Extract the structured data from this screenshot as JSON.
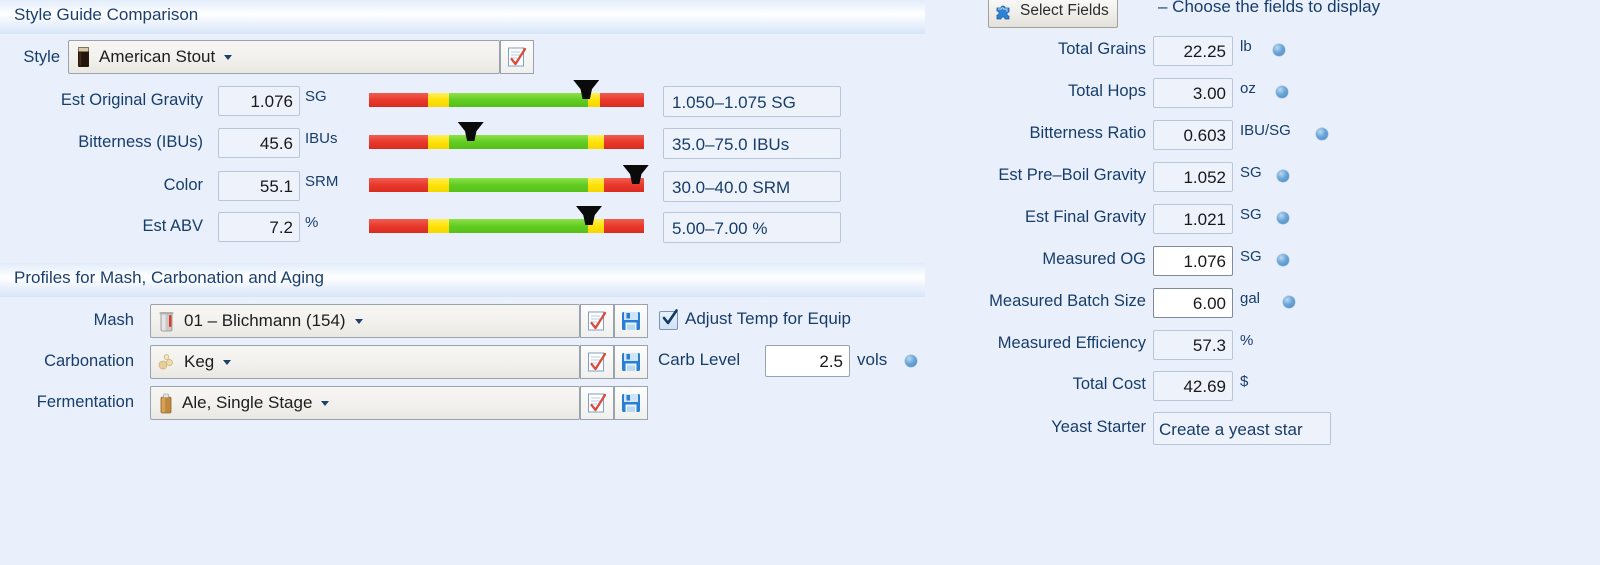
{
  "app": {
    "background_color": "#e9f0fc",
    "label_color": "#173d6b"
  },
  "style_guide_panel": {
    "header": "Style Guide Comparison",
    "style_row": {
      "label": "Style",
      "value": "American Stout",
      "icon": "stout-glass-icon",
      "action_button_icon": "checklist-check-icon"
    },
    "rows": [
      {
        "label": "Est Original Gravity",
        "value": "1.076",
        "unit": "SG",
        "range": "1.050–1.075 SG",
        "marker_percent": 79,
        "segments": [
          {
            "color": "red",
            "percent": 21.5
          },
          {
            "color": "yellow",
            "percent": 7.5
          },
          {
            "color": "green",
            "percent": 50.5
          },
          {
            "color": "yellow",
            "percent": 4.5
          },
          {
            "color": "red",
            "percent": 16.0
          }
        ]
      },
      {
        "label": "Bitterness (IBUs)",
        "value": "45.6",
        "unit": "IBUs",
        "range": "35.0–75.0 IBUs",
        "marker_percent": 37,
        "segments": [
          {
            "color": "red",
            "percent": 21.5
          },
          {
            "color": "yellow",
            "percent": 7.5
          },
          {
            "color": "green",
            "percent": 50.5
          },
          {
            "color": "yellow",
            "percent": 6.0
          },
          {
            "color": "red",
            "percent": 14.5
          }
        ]
      },
      {
        "label": "Color",
        "value": "55.1",
        "unit": "SRM",
        "range": "30.0–40.0 SRM",
        "marker_percent": 97,
        "segments": [
          {
            "color": "red",
            "percent": 21.5
          },
          {
            "color": "yellow",
            "percent": 7.5
          },
          {
            "color": "green",
            "percent": 50.5
          },
          {
            "color": "yellow",
            "percent": 6.0
          },
          {
            "color": "red",
            "percent": 14.5
          }
        ]
      },
      {
        "label": "Est ABV",
        "value": "7.2",
        "unit": "%",
        "range": "5.00–7.00 %",
        "marker_percent": 80,
        "segments": [
          {
            "color": "red",
            "percent": 21.5
          },
          {
            "color": "yellow",
            "percent": 7.5
          },
          {
            "color": "green",
            "percent": 50.5
          },
          {
            "color": "yellow",
            "percent": 6.0
          },
          {
            "color": "red",
            "percent": 14.5
          }
        ]
      }
    ]
  },
  "profiles_panel": {
    "header": "Profiles for Mash, Carbonation and Aging",
    "rows": [
      {
        "label": "Mash",
        "value": "01 – Blichmann (154)",
        "icon": "mash-tun-icon",
        "edit_icon": "checklist-check-icon",
        "save_icon": "save-disk-icon"
      },
      {
        "label": "Carbonation",
        "value": "Keg",
        "icon": "bubbles-icon",
        "edit_icon": "checklist-check-icon",
        "save_icon": "save-disk-icon"
      },
      {
        "label": "Fermentation",
        "value": "Ale, Single Stage",
        "icon": "fermenter-icon",
        "edit_icon": "checklist-check-icon",
        "save_icon": "save-disk-icon"
      }
    ],
    "adjust_temp": {
      "label": "Adjust Temp for Equip",
      "checked": true
    },
    "carb_level": {
      "label": "Carb Level",
      "value": "2.5",
      "unit": "vols"
    }
  },
  "details_panel": {
    "select_fields": {
      "label": "Select Fields",
      "icon": "puzzle-piece-icon",
      "hint": "– Choose the fields to display"
    },
    "rows": [
      {
        "label": "Total Grains",
        "value": "22.25",
        "unit": "lb",
        "editable": false,
        "has_dot": true
      },
      {
        "label": "Total Hops",
        "value": "3.00",
        "unit": "oz",
        "editable": false,
        "has_dot": true
      },
      {
        "label": "Bitterness Ratio",
        "value": "0.603",
        "unit": "IBU/SG",
        "editable": false,
        "has_dot": true
      },
      {
        "label": "Est Pre–Boil Gravity",
        "value": "1.052",
        "unit": "SG",
        "editable": false,
        "has_dot": true
      },
      {
        "label": "Est Final Gravity",
        "value": "1.021",
        "unit": "SG",
        "editable": false,
        "has_dot": true
      },
      {
        "label": "Measured OG",
        "value": "1.076",
        "unit": "SG",
        "editable": true,
        "has_dot": true
      },
      {
        "label": "Measured Batch Size",
        "value": "6.00",
        "unit": "gal",
        "editable": true,
        "has_dot": true
      },
      {
        "label": "Measured Efficiency",
        "value": "57.3",
        "unit": "%",
        "editable": false,
        "has_dot": false
      },
      {
        "label": "Total Cost",
        "value": "42.69",
        "unit": "$",
        "editable": false,
        "has_dot": false
      }
    ],
    "yeast_starter": {
      "label": "Yeast Starter",
      "value": "Create a yeast star"
    }
  }
}
